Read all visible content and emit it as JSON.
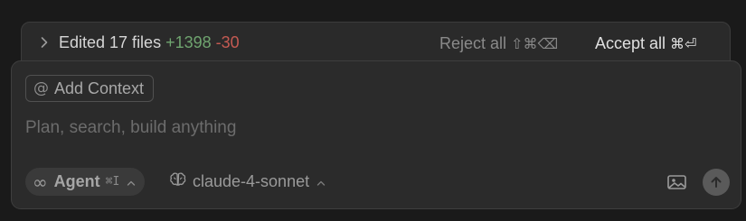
{
  "edits": {
    "summary_label": "Edited 17 files",
    "added": "+1398",
    "removed": "-30",
    "reject_label": "Reject all",
    "reject_shortcut": "⇧⌘⌫",
    "accept_label": "Accept all",
    "accept_shortcut": "⌘⏎"
  },
  "composer": {
    "add_context_label": "Add Context",
    "prompt_placeholder": "Plan, search, build anything",
    "prompt_value": "",
    "mode_label": "Agent",
    "mode_shortcut": "⌘I",
    "model_label": "claude-4-sonnet"
  },
  "icons": {
    "expand": "chevron-right-icon",
    "context": "at-sign-icon",
    "mode": "infinity-icon",
    "model": "brain-icon",
    "image": "image-icon",
    "send": "arrow-up-icon"
  },
  "colors": {
    "added": "#6fa46f",
    "removed": "#c45a52",
    "panel_bg": "#2b2b2b",
    "page_bg": "#1a1a1a"
  }
}
